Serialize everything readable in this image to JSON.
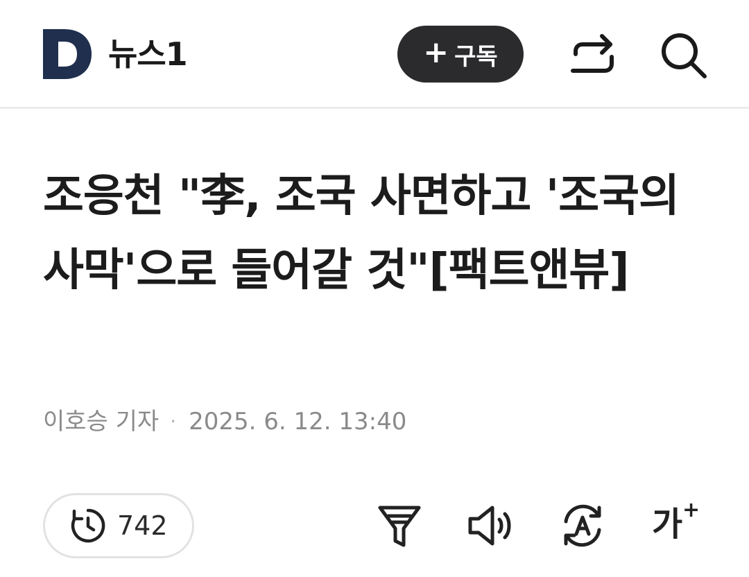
{
  "header": {
    "brand_name": "뉴스1",
    "logo_letter": "D",
    "subscribe_label": "구독",
    "subscribe_plus": "+",
    "icons": [
      "share-icon",
      "search-icon"
    ],
    "colors": {
      "logo": "#1f2f4d",
      "subscribe_bg": "#2b2b2e"
    }
  },
  "article": {
    "title": "조응천 \"李, 조국 사면하고 '조국의 사막'으로 들어갈 것\"[팩트앤뷰]",
    "author": "이호승 기자",
    "separator": "·",
    "date": "2025. 6. 12. 13:40"
  },
  "toolbar": {
    "read_count": "742",
    "font_label": "가",
    "font_plus": "+",
    "icons": [
      "clock-icon",
      "summary-filter-icon",
      "speaker-icon",
      "translate-icon",
      "font-size-icon"
    ]
  }
}
